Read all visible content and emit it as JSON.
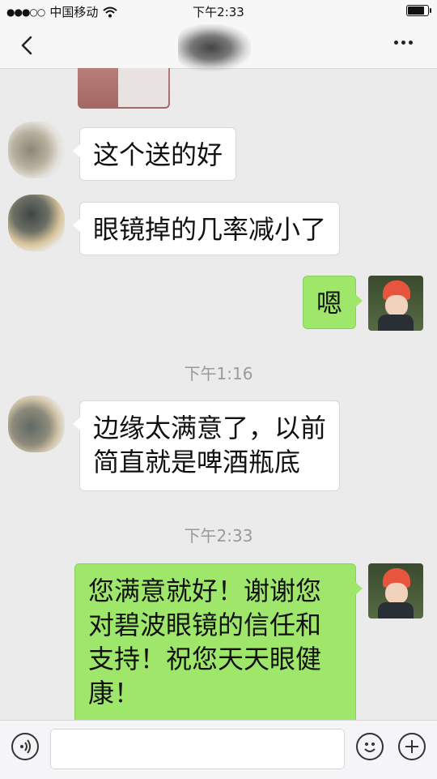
{
  "status_bar": {
    "signal": "●●●○○",
    "carrier": "中国移动",
    "wifi_icon": "wifi-icon",
    "time": "下午2:33",
    "battery_level": 0.9
  },
  "nav_bar": {
    "back_icon": "chevron-left-icon",
    "more_icon": "more-icon"
  },
  "messages": [
    {
      "side": "in",
      "text": "这个送的好"
    },
    {
      "side": "in",
      "text": "眼镜掉的几率减小了"
    },
    {
      "side": "out",
      "text": "嗯"
    },
    {
      "side": "in",
      "lines": [
        "边缘太满意了，以前",
        "简直就是啤酒瓶底"
      ]
    },
    {
      "side": "out",
      "lines": [
        "您满意就好！谢谢您",
        "对碧波眼镜的信任和",
        "支持！祝您天天眼健",
        "康！"
      ]
    }
  ],
  "timestamps": [
    "下午1:16",
    "下午2:33"
  ],
  "input_bar": {
    "voice_icon": "voice-icon",
    "emoji_icon": "emoji-icon",
    "plus_icon": "plus-icon"
  },
  "colors": {
    "outgoing_bubble": "#9fe76b",
    "incoming_bubble": "#ffffff",
    "background": "#ebebeb"
  }
}
